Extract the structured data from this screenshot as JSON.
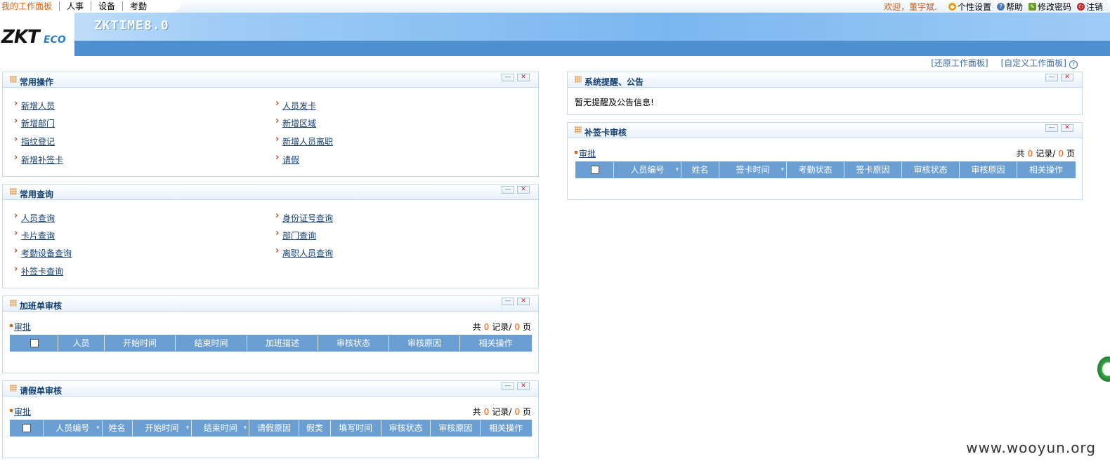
{
  "nav": {
    "menu": [
      "我的工作面板",
      "人事",
      "设备",
      "考勤"
    ],
    "logo_main": "ZKT",
    "logo_sub": "ECO",
    "product": "ZKTIME8.0",
    "welcome": "欢迎，董宇斌.",
    "user_links": [
      {
        "label": "个性设置",
        "icon": "key-icon",
        "color": "#e0a020"
      },
      {
        "label": "帮助",
        "icon": "help-icon",
        "color": "#4a7bb5"
      },
      {
        "label": "修改密码",
        "icon": "edit-password-icon",
        "color": "#6a9a2a"
      },
      {
        "label": "注销",
        "icon": "logout-icon",
        "color": "#c02020"
      }
    ],
    "restore_panel": "[还原工作面板]",
    "custom_panel": "[自定义工作面板]",
    "help_glyph": "?"
  },
  "controls": {
    "min": "—",
    "close": "✕"
  },
  "common_ops": {
    "title": "常用操作",
    "left": [
      "新增人员",
      "新增部门",
      "指纹登记",
      "新增补签卡"
    ],
    "right": [
      "人员发卡",
      "新增区域",
      "新增人员离职",
      "请假"
    ]
  },
  "common_queries": {
    "title": "常用查询",
    "left": [
      "人员查询",
      "卡片查询",
      "考勤设备查询",
      "补签卡查询"
    ],
    "right": [
      "身份证号查询",
      "部门查询",
      "离职人员查询"
    ]
  },
  "overtime": {
    "title": "加班单审核",
    "approve": "审批",
    "pager": {
      "prefix": "共",
      "records": "0",
      "mid": "记录/",
      "pages": "0",
      "suffix": "页"
    },
    "columns": [
      "人员",
      "开始时间",
      "结束时间",
      "加班描述",
      "审核状态",
      "审核原因",
      "相关操作"
    ]
  },
  "leave": {
    "title": "请假单审核",
    "approve": "审批",
    "pager": {
      "prefix": "共",
      "records": "0",
      "mid": "记录/",
      "pages": "0",
      "suffix": "页"
    },
    "columns": [
      "人员编号",
      "姓名",
      "开始时间",
      "结束时间",
      "请假原因",
      "假类",
      "填写时间",
      "审核状态",
      "审核原因",
      "相关操作"
    ]
  },
  "notices": {
    "title": "系统提醒、公告",
    "text": "暂无提醒及公告信息!"
  },
  "resign": {
    "title": "补签卡审核",
    "approve": "审批",
    "pager": {
      "prefix": "共",
      "records": "0",
      "mid": "记录/",
      "pages": "0",
      "suffix": "页"
    },
    "columns": [
      "人员编号",
      "姓名",
      "签卡时间",
      "考勤状态",
      "签卡原因",
      "审核状态",
      "审核原因",
      "相关操作"
    ]
  },
  "watermark": "www.wooyun.org"
}
